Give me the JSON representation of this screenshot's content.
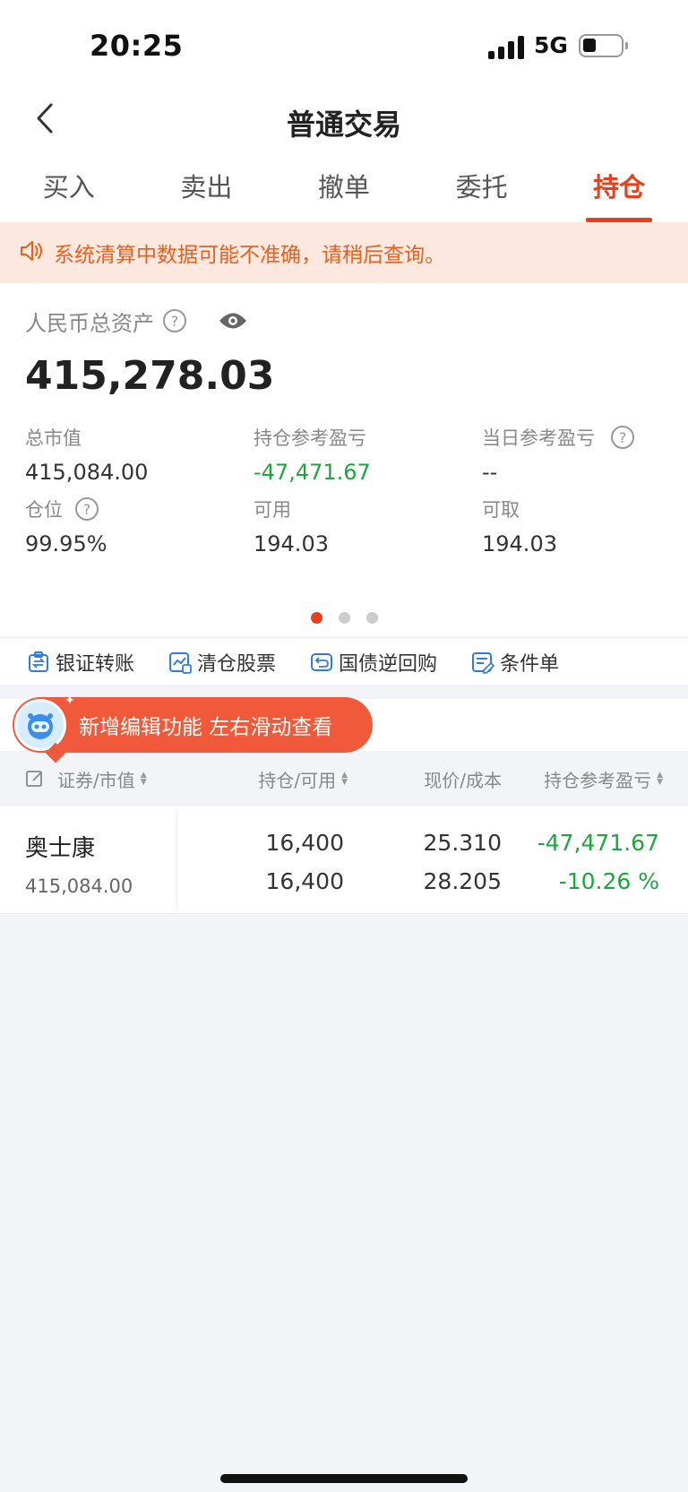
{
  "status_bar": {
    "time": "20:25",
    "network": "5G"
  },
  "nav": {
    "title": "普通交易"
  },
  "tabs": [
    {
      "label": "买入",
      "active": false
    },
    {
      "label": "卖出",
      "active": false
    },
    {
      "label": "撤单",
      "active": false
    },
    {
      "label": "委托",
      "active": false
    },
    {
      "label": "持仓",
      "active": true
    }
  ],
  "notice": {
    "text": "系统清算中数据可能不准确，请稍后查询。"
  },
  "assets": {
    "label": "人民币总资产",
    "total": "415,278.03",
    "metrics": [
      {
        "label": "总市值",
        "value": "415,084.00",
        "help": false
      },
      {
        "label": "持仓参考盈亏",
        "value": "-47,471.67",
        "help": false
      },
      {
        "label": "当日参考盈亏",
        "value": "--",
        "help": true
      },
      {
        "label": "仓位",
        "value": "99.95%",
        "help": true
      },
      {
        "label": "可用",
        "value": "194.03",
        "help": false
      },
      {
        "label": "可取",
        "value": "194.03",
        "help": false
      }
    ],
    "page_dots": {
      "count": 3,
      "active": 1
    }
  },
  "actions": [
    {
      "label": "银证转账",
      "icon": "transfer-icon"
    },
    {
      "label": "清仓股票",
      "icon": "chart-icon"
    },
    {
      "label": "国债逆回购",
      "icon": "repo-icon"
    },
    {
      "label": "条件单",
      "icon": "condition-order-icon"
    }
  ],
  "promo": {
    "text": "新增编辑功能 左右滑动查看"
  },
  "table": {
    "headers": {
      "security": "证券/市值",
      "position": "持仓/可用",
      "price": "现价/成本",
      "pnl": "持仓参考盈亏"
    },
    "rows": [
      {
        "name": "奥士康",
        "market_value": "415,084.00",
        "position": "16,400",
        "available": "16,400",
        "price": "25.310",
        "cost": "28.205",
        "pnl": "-47,471.67",
        "pnl_pct": "-10.26 %"
      }
    ]
  },
  "colors": {
    "accent": "#e8401c",
    "loss": "#1fa540",
    "notice_bg": "#fde8df",
    "notice_text": "#e8611c"
  }
}
